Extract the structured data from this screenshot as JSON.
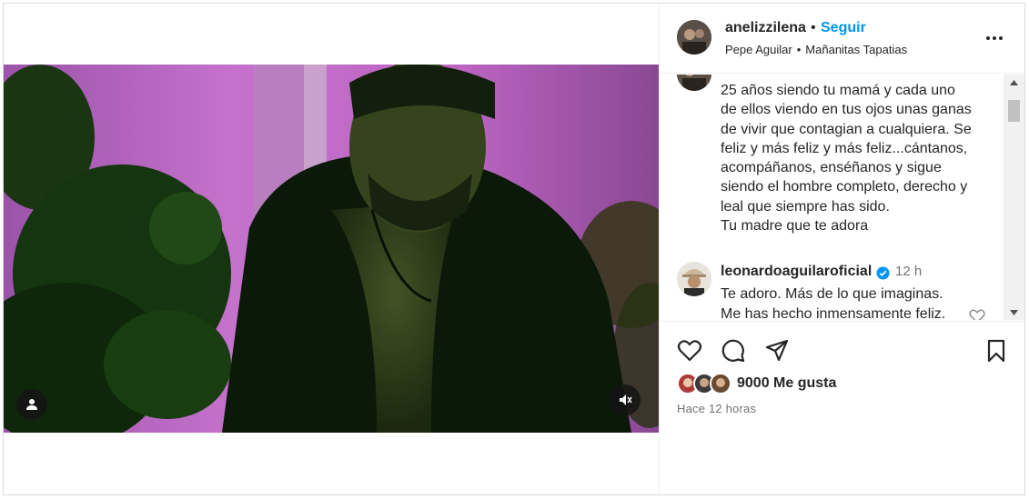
{
  "post": {
    "username": "anelizzilena",
    "separator": "•",
    "follow_label": "Seguir",
    "audio_artist": "Pepe Aguilar",
    "audio_separator": "•",
    "audio_track": "Mañanitas Tapatias",
    "more_icon": "more-horizontal-icon"
  },
  "caption": {
    "text": "25 años siendo tu mamá y cada uno\nde ellos viendo en tus ojos unas ganas\nde vivir que contagian a cualquiera. Se\nfeliz y más feliz y más feliz...cántanos,\nacompáñanos, enséñanos y sigue\nsiendo el hombre completo, derecho y\nleal que siempre has sido.\nTu madre que te adora"
  },
  "comments": [
    {
      "username": "leonardoaguilaroficial",
      "verified": true,
      "time": "12 h",
      "text": "Te adoro. Más de lo que imaginas.\nMe has hecho inmensamente feliz."
    }
  ],
  "actions": {
    "like_icon": "heart-icon",
    "comment_icon": "comment-icon",
    "share_icon": "paper-plane-icon",
    "save_icon": "bookmark-icon"
  },
  "likes": {
    "count_label": "9000 Me gusta"
  },
  "timestamp": "Hace 12 horas",
  "colors": {
    "accent": "#0095f6",
    "text": "#262626",
    "secondary": "#737373",
    "verified": "#0095f6"
  }
}
